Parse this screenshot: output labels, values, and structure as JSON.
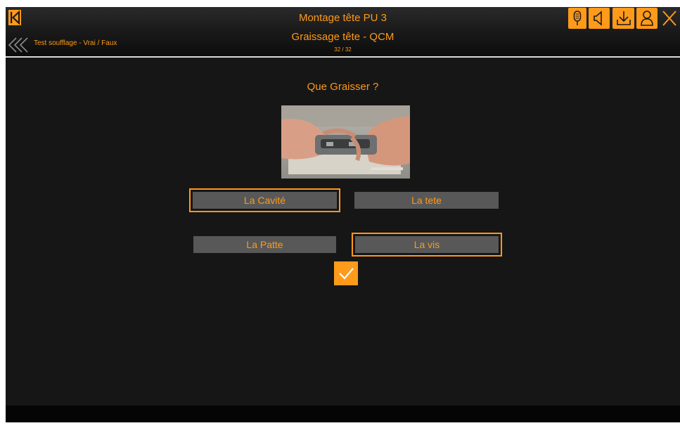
{
  "header": {
    "module_title": "Montage tête PU 3",
    "section_title": "Graissage tête - QCM",
    "page_counter": "32 / 32",
    "previous_label": "Test soufflage - Vrai / Faux"
  },
  "icons": {
    "home": "skip-back-icon",
    "back": "double-chevron-left-icon",
    "tools": [
      "microphone-icon",
      "speaker-icon",
      "download-icon",
      "user-icon"
    ],
    "close": "close-icon"
  },
  "question": {
    "text": "Que Graisser ?"
  },
  "answers": [
    {
      "label": "La Cavité",
      "selected": true
    },
    {
      "label": "La tete",
      "selected": false
    },
    {
      "label": "La Patte",
      "selected": false
    },
    {
      "label": "La vis",
      "selected": true
    }
  ],
  "colors": {
    "accent": "#ff9a1a",
    "background": "#161616",
    "answer_bg": "#585858"
  }
}
